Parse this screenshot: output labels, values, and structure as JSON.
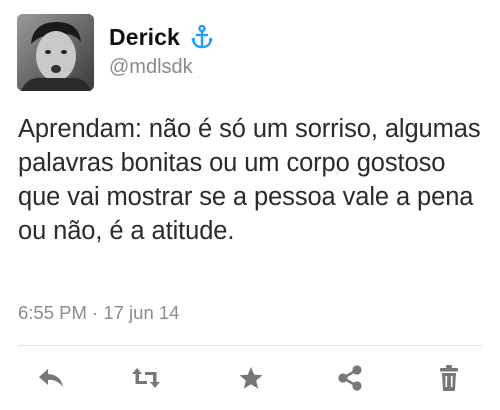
{
  "author": {
    "display_name": "Derick",
    "handle": "@mdlsdk",
    "badge_icon": "anchor-icon",
    "badge_color": "#1da1f2"
  },
  "tweet": {
    "text": "Aprendam: não é só um sorriso, algumas palavras bonitas ou um corpo gostoso que vai mostrar se a pessoa vale a pena ou não, é a atitude.",
    "timestamp": "6:55 PM · 17 jun 14"
  },
  "actions": [
    {
      "icon": "reply-icon"
    },
    {
      "icon": "retweet-icon"
    },
    {
      "icon": "star-icon"
    },
    {
      "icon": "share-icon"
    },
    {
      "icon": "trash-icon"
    }
  ],
  "colors": {
    "action_icon": "#777777",
    "meta_text": "#8c8c8c"
  }
}
